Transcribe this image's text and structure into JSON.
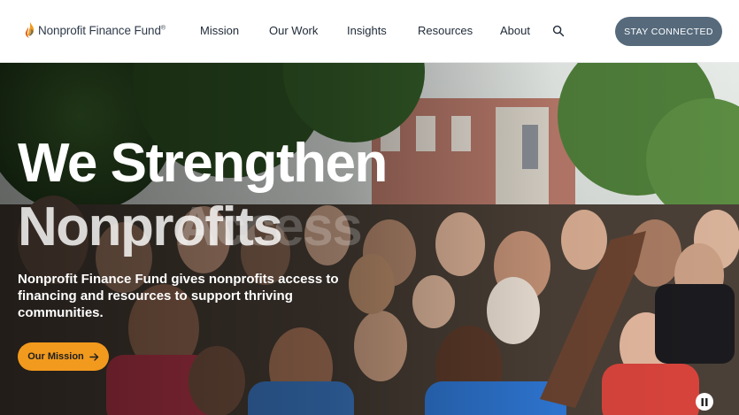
{
  "brand": {
    "name": "Nonprofit Finance Fund",
    "reg_mark": "®",
    "logo_icon": "flame-logo-icon",
    "colors": {
      "orange": "#f29a1d",
      "navy": "#2f3a4a",
      "slate": "#566a7c"
    }
  },
  "nav": {
    "items": [
      {
        "label": "Mission"
      },
      {
        "label": "Our Work"
      },
      {
        "label": "Insights"
      },
      {
        "label": "Resources"
      },
      {
        "label": "About"
      }
    ],
    "search_icon": "search-icon",
    "cta_label": "STAY CONNECTED"
  },
  "hero": {
    "headline_line1": "We Strengthen",
    "headline_word_current": "Nonprofits",
    "headline_word_next": "Access",
    "subhead": "Nonprofit Finance Fund gives nonprofits access to financing and resources to support thriving communities.",
    "button_label": "Our Mission",
    "button_icon": "arrow-right-icon",
    "pause_icon": "pause-icon"
  }
}
